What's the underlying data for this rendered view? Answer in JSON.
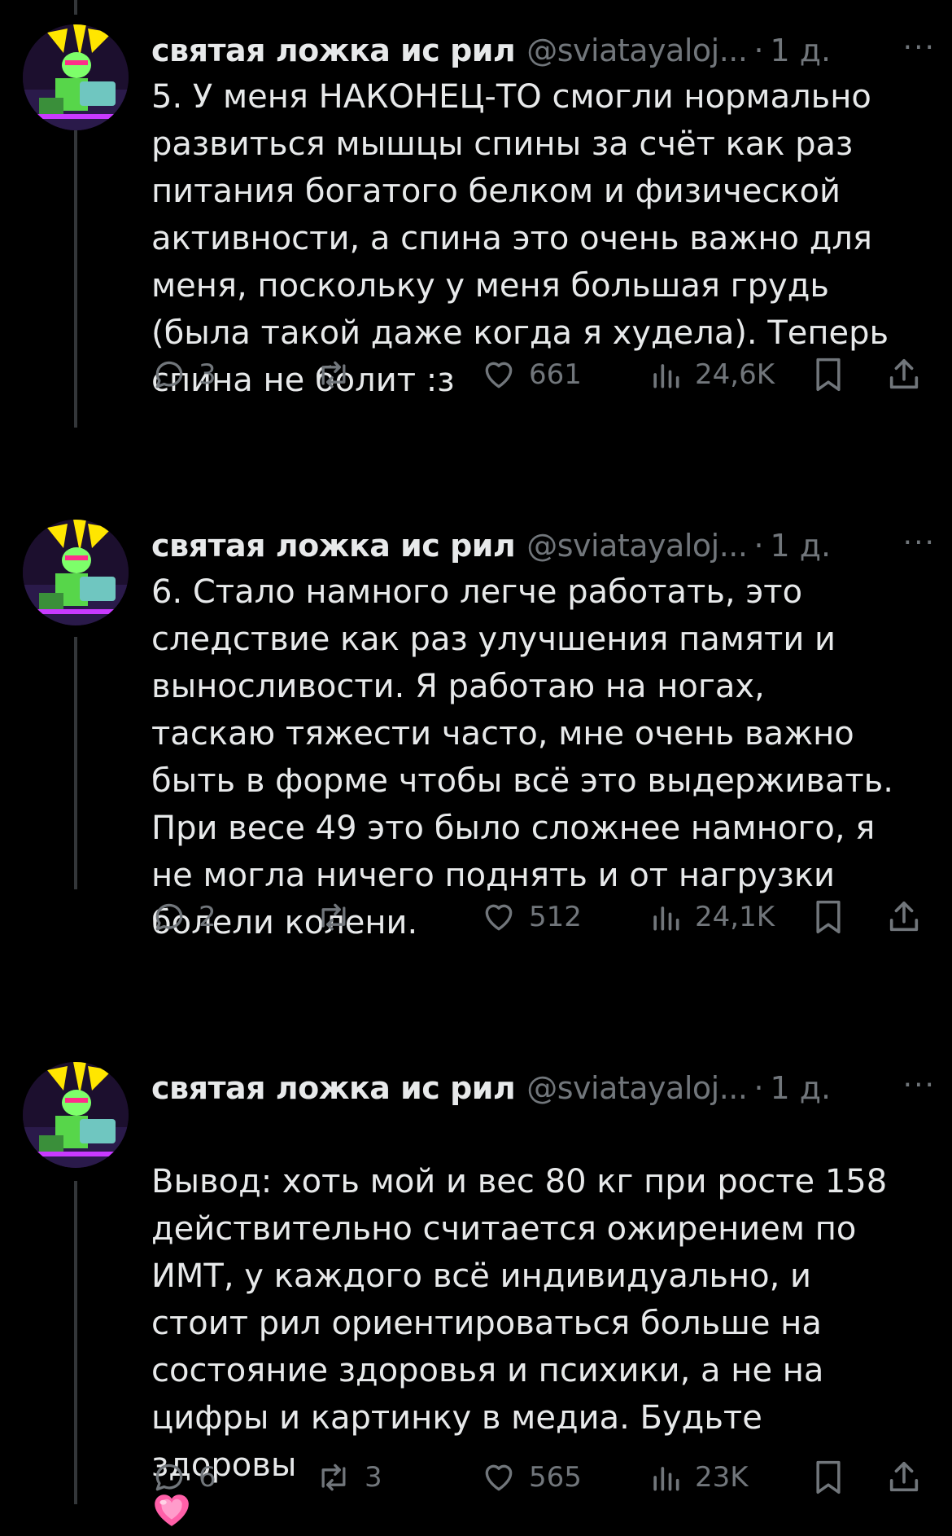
{
  "author": {
    "name": "святая ложка ис рил",
    "handle": "@sviatayaloj...",
    "separator": "·",
    "time": "1 д.",
    "more": "···"
  },
  "colors": {
    "background": "#000000",
    "text": "#e7e9ea",
    "muted": "#71767b",
    "emoji_heart": "#ff5fa8"
  },
  "icons": {
    "reply": "reply-bubble-icon",
    "retweet": "retweet-icon",
    "like": "heart-icon",
    "views": "views-bar-chart-icon",
    "bookmark": "bookmark-icon",
    "share": "share-upload-icon"
  },
  "tweets": [
    {
      "text": "5. У меня НАКОНЕЦ-ТО смогли нормально\nразвиться мышцы спины за счёт как раз\nпитания богатого белком и физической\nактивности, а спина это очень важно для\nменя, поскольку у меня большая грудь\n(была такой даже когда я худела). Теперь\nспина не болит :з",
      "replies": "3",
      "retweets": "",
      "likes": "661",
      "views": "24,6K"
    },
    {
      "text": "6. Стало намного легче работать, это\nследствие как раз улучшения памяти и\nвыносливости. Я работаю на ногах,\nтаскаю тяжести часто, мне очень важно\nбыть в форме чтобы всё это выдерживать.\nПри весе 49 это было сложнее намного, я\nне могла ничего поднять и от нагрузки\nболели колени.",
      "replies": "2",
      "retweets": "",
      "likes": "512",
      "views": "24,1K"
    },
    {
      "text": "Вывод: хоть мой и вес 80 кг при росте 158\nдействительно считается ожирением по\nИМТ, у каждого всё индивидуально, и\nстоит рил ориентироваться больше на\nсостояние здоровья и психики, а не на\nцифры и картинку в медиа. Будьте\nздоровы",
      "emoji": "growing-heart-emoji",
      "replies": "6",
      "retweets": "3",
      "likes": "565",
      "views": "23K"
    }
  ]
}
